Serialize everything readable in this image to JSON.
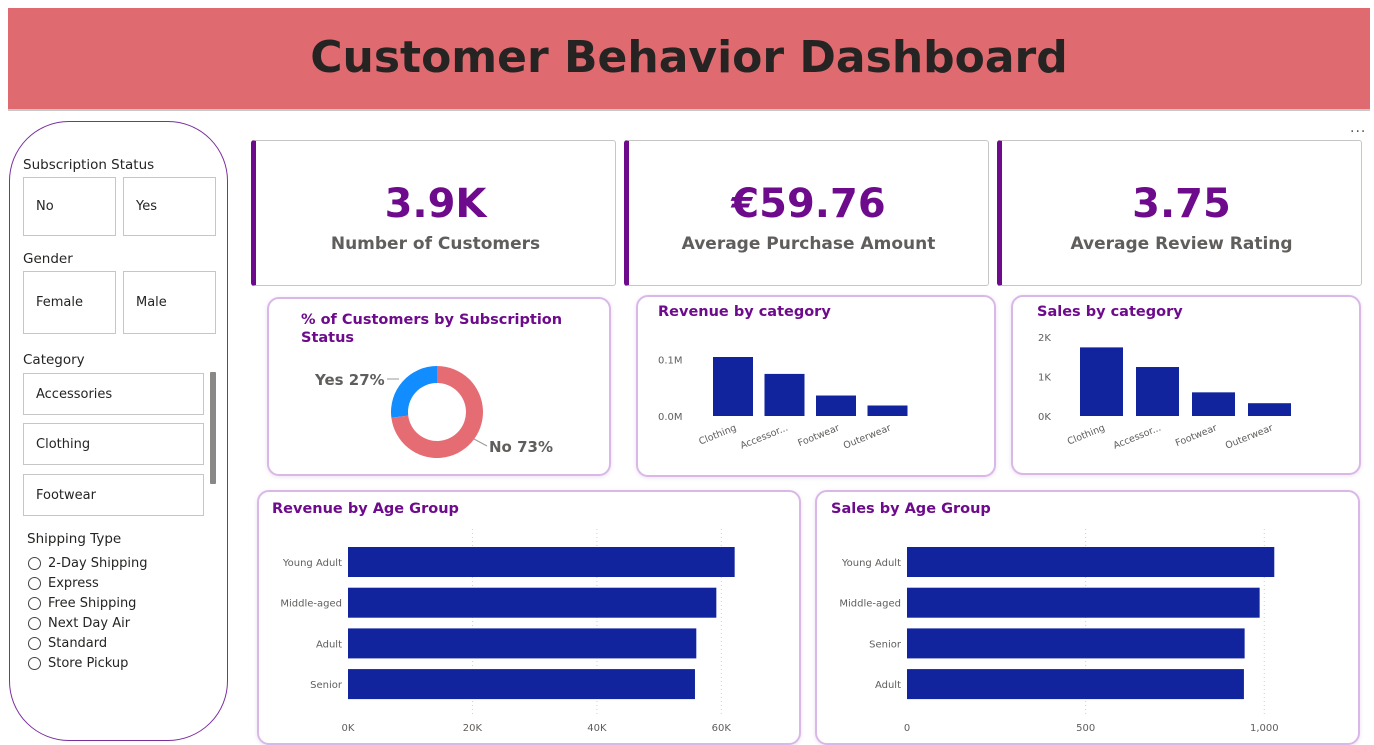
{
  "header": {
    "title": "Customer Behavior Dashboard"
  },
  "more_options_label": "...",
  "colors": {
    "header_bg": "#df6a70",
    "accent": "#6e0a8c",
    "bar": "#12239e",
    "donut_yes": "#118dff",
    "donut_no": "#e66c74"
  },
  "slicers": {
    "subscription": {
      "title": "Subscription Status",
      "options": [
        "No",
        "Yes"
      ]
    },
    "gender": {
      "title": "Gender",
      "options": [
        "Female",
        "Male"
      ]
    },
    "category": {
      "title": "Category",
      "options": [
        "Accessories",
        "Clothing",
        "Footwear"
      ]
    },
    "shipping": {
      "title": "Shipping Type",
      "options": [
        "2-Day Shipping",
        "Express",
        "Free Shipping",
        "Next Day Air",
        "Standard",
        "Store Pickup"
      ]
    }
  },
  "kpis": [
    {
      "value": "3.9K",
      "label": "Number of Customers"
    },
    {
      "value": "€59.76",
      "label": "Average Purchase Amount"
    },
    {
      "value": "3.75",
      "label": "Average Review Rating"
    }
  ],
  "chart_data": [
    {
      "id": "subscription_donut",
      "type": "pie",
      "title": "% of Customers by Subscription Status",
      "categories": [
        "Yes",
        "No"
      ],
      "values": [
        27,
        73
      ],
      "labels": [
        "Yes 27%",
        "No 73%"
      ]
    },
    {
      "id": "revenue_by_category",
      "type": "bar",
      "title": "Revenue by category",
      "categories": [
        "Clothing",
        "Accessor...",
        "Footwear",
        "Outerwear"
      ],
      "values": [
        104000,
        74200,
        36100,
        18500
      ],
      "ylim": [
        0,
        104000
      ],
      "yticks": [
        0,
        100000
      ],
      "ytick_labels": [
        "0.0M",
        "0.1M"
      ],
      "xlabel": "",
      "ylabel": ""
    },
    {
      "id": "sales_by_category",
      "type": "bar",
      "title": "Sales by category",
      "categories": [
        "Clothing",
        "Accessor...",
        "Footwear",
        "Outerwear"
      ],
      "values": [
        1737,
        1240,
        599,
        324
      ],
      "ylim": [
        0,
        2000
      ],
      "yticks": [
        0,
        1000,
        2000
      ],
      "ytick_labels": [
        "0K",
        "1K",
        "2K"
      ],
      "xlabel": "",
      "ylabel": ""
    },
    {
      "id": "revenue_by_age_group",
      "type": "bar",
      "orientation": "horizontal",
      "title": "Revenue by Age Group",
      "categories": [
        "Young Adult",
        "Middle-aged",
        "Adult",
        "Senior"
      ],
      "values": [
        62143,
        59197,
        55978,
        55763
      ],
      "xlim": [
        0,
        63000
      ],
      "xticks": [
        0,
        20000,
        40000,
        60000
      ],
      "xtick_labels": [
        "0K",
        "20K",
        "40K",
        "60K"
      ],
      "grid": true
    },
    {
      "id": "sales_by_age_group",
      "type": "bar",
      "orientation": "horizontal",
      "title": "Sales by Age Group",
      "categories": [
        "Young Adult",
        "Middle-aged",
        "Senior",
        "Adult"
      ],
      "values": [
        1028,
        987,
        945,
        943
      ],
      "xlim": [
        0,
        1030
      ],
      "xticks": [
        0,
        500,
        1000
      ],
      "xtick_labels": [
        "0",
        "500",
        "1,000"
      ],
      "grid": true
    }
  ]
}
